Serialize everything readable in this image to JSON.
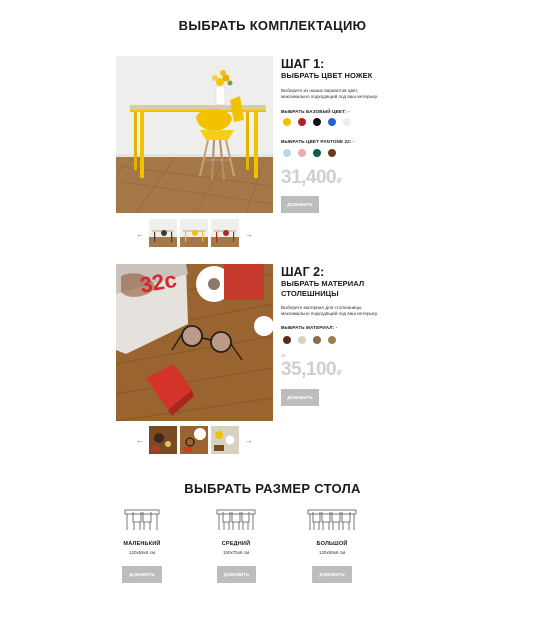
{
  "page": {
    "title": "ВЫБРАТЬ КОМПЛЕКТАЦИЮ"
  },
  "step1": {
    "title": "ШАГ 1:",
    "subtitle": "ВЫБРАТЬ ЦВЕТ НОЖЕК",
    "description_line1": "Выберите из наших вариантов цвет,",
    "description_line2": "максимально подходящий под ваш интерьер.",
    "base_color_label": "ВЫБРАТЬ БАЗОВЫЙ ЦВЕТ: -",
    "base_colors": [
      "#f2c200",
      "#b42222",
      "#111111",
      "#2b5fc9",
      "#ededed"
    ],
    "pantone_label": "ВЫБРАТЬ ЦВЕТ PANTONE 22: -",
    "pantone_colors": [
      "#b9d8ec",
      "#f0a7b8",
      "#0f5c4c",
      "#6b3a22"
    ],
    "price": "31,400",
    "currency": "₽",
    "add_button": "ДОБАВИТЬ",
    "prev_arrow": "←",
    "next_arrow": "→"
  },
  "step2": {
    "title": "ШАГ 2:",
    "subtitle_line1": "ВЫБРАТЬ МАТЕРИАЛ",
    "subtitle_line2": "СТОЛЕШНИЦЫ",
    "description_line1": "Выберите материал для столешницы,",
    "description_line2": "максимально подходящий под ваш интерьер.",
    "material_label": "ВЫБРАТЬ МАТЕРИАЛ: -",
    "material_colors": [
      "#5a2e14",
      "#d9d2c3",
      "#8b6b4a",
      "#9c8150"
    ],
    "price_prefix": "от",
    "price": "35,100",
    "currency": "₽",
    "add_button": "ДОБАВИТЬ",
    "prev_arrow": "←",
    "next_arrow": "→",
    "magazine_text": "32c"
  },
  "size_section": {
    "title": "ВЫБРАТЬ РАЗМЕР СТОЛА",
    "sizes": [
      {
        "name": "МАЛЕНЬКИЙ",
        "dims": "120х59х6 см",
        "button": "ДОБАВИТЬ",
        "chairs": 2
      },
      {
        "name": "СРЕДНИЙ",
        "dims": "150х75х6 см",
        "button": "ДОБАВИТЬ",
        "chairs": 3
      },
      {
        "name": "БОЛЬШОЙ",
        "dims": "120х59х6 см",
        "button": "ДОБАВИТЬ",
        "chairs": 4
      }
    ]
  }
}
